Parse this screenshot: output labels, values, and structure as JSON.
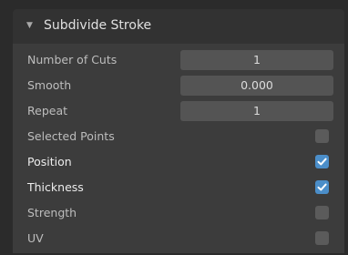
{
  "panel": {
    "title": "Subdivide Stroke",
    "expanded": true,
    "accent_color": "#4b8ec9"
  },
  "fields": {
    "number_of_cuts": {
      "label": "Number of Cuts",
      "value": "1"
    },
    "smooth": {
      "label": "Smooth",
      "value": "0.000"
    },
    "repeat": {
      "label": "Repeat",
      "value": "1"
    }
  },
  "checkboxes": {
    "selected_points": {
      "label": "Selected Points",
      "checked": false
    },
    "position": {
      "label": "Position",
      "checked": true
    },
    "thickness": {
      "label": "Thickness",
      "checked": true
    },
    "strength": {
      "label": "Strength",
      "checked": false
    },
    "uv": {
      "label": "UV",
      "checked": false
    }
  },
  "icons": {
    "collapse": "disclosure-triangle-down-icon",
    "check": "checkmark-icon"
  }
}
